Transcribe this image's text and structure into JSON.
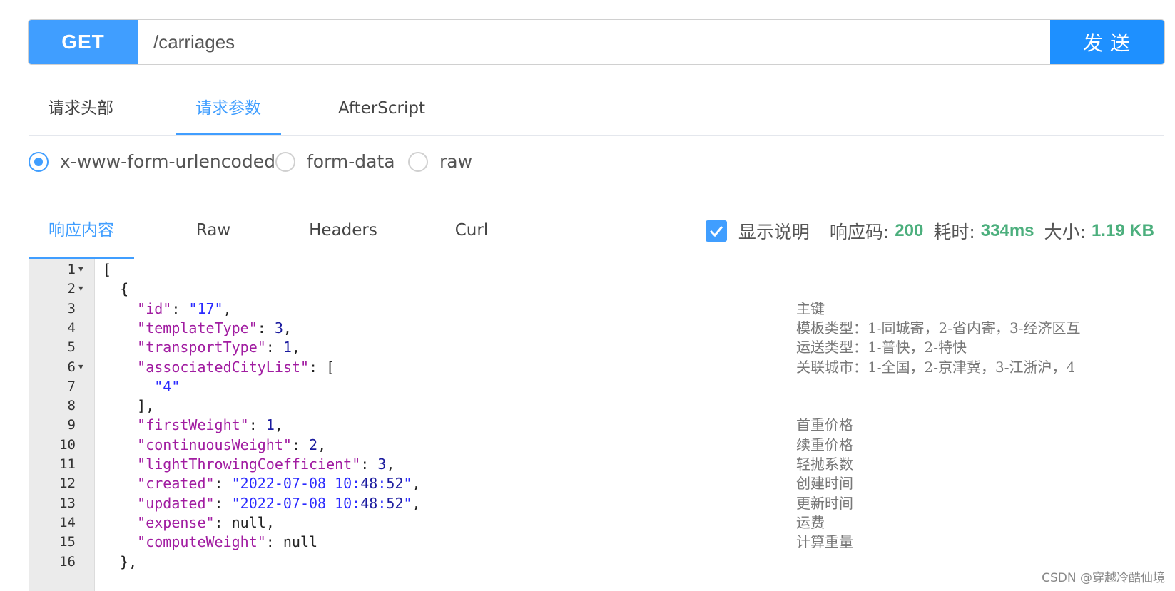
{
  "request": {
    "method": "GET",
    "url": "/carriages",
    "send_label": "发送"
  },
  "request_tabs": [
    {
      "label": "请求头部",
      "active": false
    },
    {
      "label": "请求参数",
      "active": true
    },
    {
      "label": "AfterScript",
      "active": false
    }
  ],
  "body_types": [
    {
      "label": "x-www-form-urlencoded",
      "checked": true
    },
    {
      "label": "form-data",
      "checked": false
    },
    {
      "label": "raw",
      "checked": false
    }
  ],
  "response_tabs": [
    {
      "label": "响应内容",
      "active": true
    },
    {
      "label": "Raw",
      "active": false
    },
    {
      "label": "Headers",
      "active": false
    },
    {
      "label": "Curl",
      "active": false
    }
  ],
  "response_meta": {
    "show_desc_label": "显示说明",
    "show_desc_checked": true,
    "status_label": "响应码:",
    "status_value": "200",
    "time_label": "耗时:",
    "time_value": "334ms",
    "size_label": "大小:",
    "size_value": "1.19 KB"
  },
  "code_lines": [
    {
      "n": "1",
      "fold": true,
      "text": "[",
      "comment": ""
    },
    {
      "n": "2",
      "fold": true,
      "text": "  {",
      "comment": ""
    },
    {
      "n": "3",
      "fold": false,
      "text": "    \"id\": \"17\",",
      "comment": "主键"
    },
    {
      "n": "4",
      "fold": false,
      "text": "    \"templateType\": 3,",
      "comment": "模板类型：1-同城寄，2-省内寄，3-经济区互"
    },
    {
      "n": "5",
      "fold": false,
      "text": "    \"transportType\": 1,",
      "comment": "运送类型：1-普快，2-特快"
    },
    {
      "n": "6",
      "fold": true,
      "text": "    \"associatedCityList\": [",
      "comment": "关联城市：1-全国，2-京津冀，3-江浙沪，4"
    },
    {
      "n": "7",
      "fold": false,
      "text": "      \"4\"",
      "comment": ""
    },
    {
      "n": "8",
      "fold": false,
      "text": "    ],",
      "comment": ""
    },
    {
      "n": "9",
      "fold": false,
      "text": "    \"firstWeight\": 1,",
      "comment": "首重价格"
    },
    {
      "n": "10",
      "fold": false,
      "text": "    \"continuousWeight\": 2,",
      "comment": "续重价格"
    },
    {
      "n": "11",
      "fold": false,
      "text": "    \"lightThrowingCoefficient\": 3,",
      "comment": "轻抛系数"
    },
    {
      "n": "12",
      "fold": false,
      "text": "    \"created\": \"2022-07-08 10:48:52\",",
      "comment": "创建时间"
    },
    {
      "n": "13",
      "fold": false,
      "text": "    \"updated\": \"2022-07-08 10:48:52\",",
      "comment": "更新时间"
    },
    {
      "n": "14",
      "fold": false,
      "text": "    \"expense\": null,",
      "comment": "运费"
    },
    {
      "n": "15",
      "fold": false,
      "text": "    \"computeWeight\": null",
      "comment": "计算重量"
    },
    {
      "n": "16",
      "fold": false,
      "text": "  },",
      "comment": ""
    }
  ],
  "watermark": "CSDN @穿越冷酷仙境",
  "colors": {
    "accent": "#409eff",
    "send": "#1e90ff",
    "success": "#4caf7d"
  }
}
